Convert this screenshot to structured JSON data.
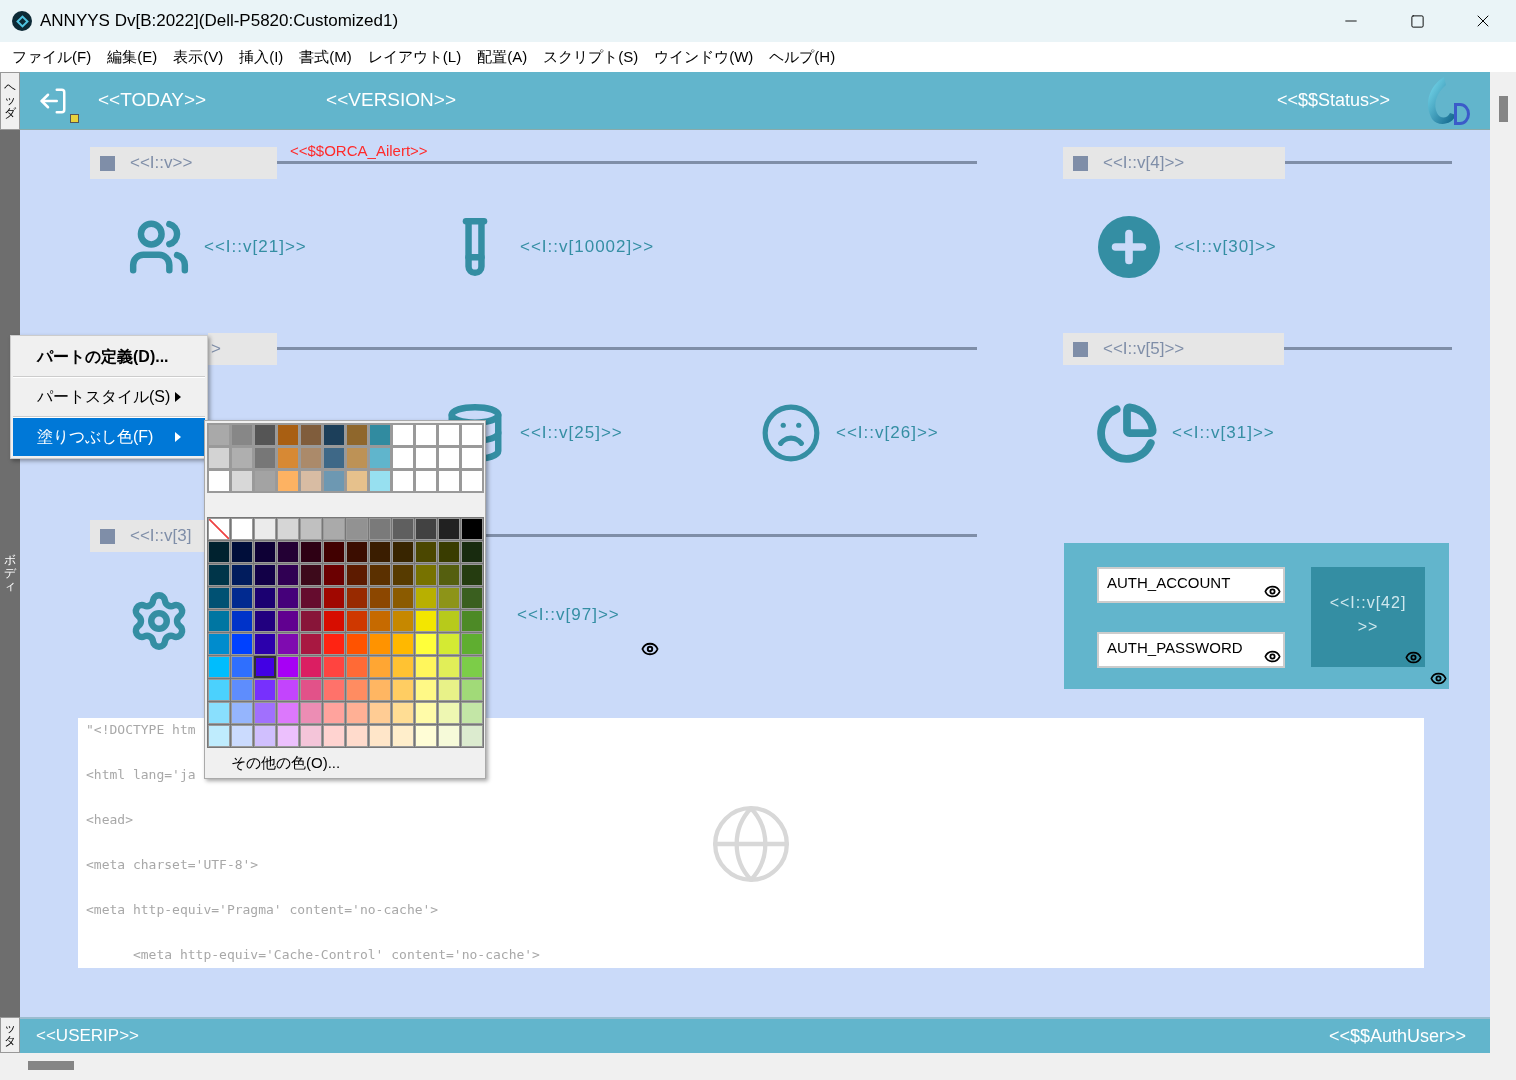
{
  "window": {
    "title": "ANNYYS Dv[B:2022](Dell-P5820:Customized1)"
  },
  "menu_bar": [
    "ファイル(F)",
    "編集(E)",
    "表示(V)",
    "挿入(I)",
    "書式(M)",
    "レイアウト(L)",
    "配置(A)",
    "スクリプト(S)",
    "ウインドウ(W)",
    "ヘルプ(H)"
  ],
  "bands": {
    "header": "ヘッダ",
    "body": "ボディ",
    "footer": "ッタ"
  },
  "header": {
    "today": "<<TODAY>>",
    "version": "<<VERSION>>",
    "status": "<<$$Status>>"
  },
  "alert": "<<$$ORCA_Ailert>>",
  "group_bars": [
    {
      "label": "<<I::v>>",
      "kind": "full"
    },
    {
      "label": "<<I::v[4]>>",
      "kind": "full"
    },
    {
      "label": ">",
      "kind": "tail"
    },
    {
      "label": "<<I::v[5]>>",
      "kind": "full"
    },
    {
      "label": "<<I::v[3]",
      "kind": "full"
    }
  ],
  "fields": [
    {
      "kind": "people",
      "label": "<<I::v[21]>>"
    },
    {
      "kind": "tube",
      "label": "<<I::v[10002]>>"
    },
    {
      "kind": "plus",
      "label": "<<I::v[30]>>"
    },
    {
      "kind": "database",
      "label": "<<I::v[25]>>"
    },
    {
      "kind": "sad",
      "label": "<<I::v[26]>>"
    },
    {
      "kind": "pie",
      "label": "<<I::v[31]>>"
    },
    {
      "kind": "gear"
    },
    {
      "kind": "none",
      "label": "<<I::v[97]>>"
    }
  ],
  "auth": {
    "account": "AUTH_ACCOUNT",
    "password": "AUTH_PASSWORD",
    "box_label": "<<I::v[42]\n>>"
  },
  "code_lines": [
    "\"<!DOCTYPE htm",
    "<html lang='ja",
    "<head>",
    "<meta charset='UTF-8'>",
    "<meta http-equiv='Pragma' content='no-cache'>",
    "      <meta http-equiv='Cache-Control' content='no-cache'>"
  ],
  "footer": {
    "left": "<<USERIP>>",
    "right": "<<$$AuthUser>>"
  },
  "context_menu": [
    {
      "label": "パートの定義(D)...",
      "submenu": false,
      "selected": false
    },
    {
      "label": "パートスタイル(S)",
      "submenu": true,
      "selected": false
    },
    {
      "label": "塗りつぶし色(F)",
      "submenu": true,
      "selected": true
    }
  ],
  "palette": {
    "custom_rows": [
      [
        {
          "color": "#a9a9a9",
          "selected": false
        },
        {
          "color": "#878787",
          "selected": false
        },
        {
          "color": "#555555",
          "selected": false
        },
        {
          "color": "#a95f12",
          "selected": false
        },
        {
          "color": "#805d3c",
          "selected": false
        },
        {
          "color": "#1c3f5a",
          "selected": false
        },
        {
          "color": "#8f672c",
          "selected": false
        },
        {
          "color": "#318ba0",
          "selected": false
        },
        {
          "color": "#ffffff",
          "selected": false
        },
        {
          "color": "#ffffff",
          "selected": false
        },
        {
          "color": "#ffffff",
          "selected": false
        },
        {
          "color": "#ffffff",
          "selected": false
        }
      ],
      [
        {
          "color": "#d3d3d3",
          "selected": false
        },
        {
          "color": "#afafaf",
          "selected": false
        },
        {
          "color": "#777777",
          "selected": false
        },
        {
          "color": "#d78934",
          "selected": false
        },
        {
          "color": "#ab8a6a",
          "selected": false
        },
        {
          "color": "#3e6887",
          "selected": false
        },
        {
          "color": "#bd9256",
          "selected": false
        },
        {
          "color": "#60b5cc",
          "selected": false
        },
        {
          "color": "#ffffff",
          "selected": false
        },
        {
          "color": "#ffffff",
          "selected": false
        },
        {
          "color": "#ffffff",
          "selected": false
        },
        {
          "color": "#ffffff",
          "selected": false
        }
      ],
      [
        {
          "color": "#ffffff",
          "selected": false
        },
        {
          "color": "#d8d8d8",
          "selected": false
        },
        {
          "color": "#a3a3a3",
          "selected": false
        },
        {
          "color": "#fdb262",
          "selected": false
        },
        {
          "color": "#d8bca3",
          "selected": false
        },
        {
          "color": "#6d98b2",
          "selected": false
        },
        {
          "color": "#e6c18c",
          "selected": false
        },
        {
          "color": "#97e0f0",
          "selected": false
        },
        {
          "color": "#ffffff",
          "selected": false
        },
        {
          "color": "#ffffff",
          "selected": false
        },
        {
          "color": "#ffffff",
          "selected": false
        },
        {
          "color": "#ffffff",
          "selected": false
        }
      ]
    ],
    "no_fill_swatch": {
      "selected": false
    },
    "gray_row": [
      {
        "color": "#ffffff",
        "selected": false
      },
      {
        "color": "#ebebeb",
        "selected": false
      },
      {
        "color": "#d6d6d6",
        "selected": false
      },
      {
        "color": "#c0c0c0",
        "selected": false
      },
      {
        "color": "#aaaaaa",
        "selected": false
      },
      {
        "color": "#929292",
        "selected": false
      },
      {
        "color": "#7a7a7a",
        "selected": false
      },
      {
        "color": "#5f5f5f",
        "selected": false
      },
      {
        "color": "#424242",
        "selected": false
      },
      {
        "color": "#212121",
        "selected": false
      },
      {
        "color": "#000000",
        "selected": false
      }
    ],
    "color_rows": [
      [
        {
          "color": "#00222f",
          "selected": false
        },
        {
          "color": "#000e3a",
          "selected": false
        },
        {
          "color": "#0e0035",
          "selected": false
        },
        {
          "color": "#230034",
          "selected": false
        },
        {
          "color": "#2e0014",
          "selected": false
        },
        {
          "color": "#410000",
          "selected": false
        },
        {
          "color": "#3b0d00",
          "selected": false
        },
        {
          "color": "#3a1d00",
          "selected": false
        },
        {
          "color": "#382500",
          "selected": false
        },
        {
          "color": "#4b4700",
          "selected": false
        },
        {
          "color": "#393c00",
          "selected": false
        },
        {
          "color": "#182b0f",
          "selected": false
        }
      ],
      [
        {
          "color": "#003549",
          "selected": false
        },
        {
          "color": "#011c5d",
          "selected": false
        },
        {
          "color": "#120047",
          "selected": false
        },
        {
          "color": "#300053",
          "selected": false
        },
        {
          "color": "#3d0a1b",
          "selected": false
        },
        {
          "color": "#6b0001",
          "selected": false
        },
        {
          "color": "#5d1b00",
          "selected": false
        },
        {
          "color": "#5b3000",
          "selected": false
        },
        {
          "color": "#573b00",
          "selected": false
        },
        {
          "color": "#777200",
          "selected": false
        },
        {
          "color": "#555f0f",
          "selected": false
        },
        {
          "color": "#253c10",
          "selected": false
        }
      ],
      [
        {
          "color": "#005173",
          "selected": false
        },
        {
          "color": "#012a90",
          "selected": false
        },
        {
          "color": "#1b0071",
          "selected": false
        },
        {
          "color": "#45007a",
          "selected": false
        },
        {
          "color": "#650c2e",
          "selected": false
        },
        {
          "color": "#a00700",
          "selected": false
        },
        {
          "color": "#982a00",
          "selected": false
        },
        {
          "color": "#8c4700",
          "selected": false
        },
        {
          "color": "#8b5b00",
          "selected": false
        },
        {
          "color": "#b8b000",
          "selected": false
        },
        {
          "color": "#8d9418",
          "selected": false
        },
        {
          "color": "#3a5f1f",
          "selected": false
        }
      ],
      [
        {
          "color": "#0076a2",
          "selected": false
        },
        {
          "color": "#0033c9",
          "selected": false
        },
        {
          "color": "#21007f",
          "selected": false
        },
        {
          "color": "#610090",
          "selected": false
        },
        {
          "color": "#881539",
          "selected": false
        },
        {
          "color": "#d70d00",
          "selected": false
        },
        {
          "color": "#cf3800",
          "selected": false
        },
        {
          "color": "#c66a00",
          "selected": false
        },
        {
          "color": "#c68800",
          "selected": false
        },
        {
          "color": "#f3e600",
          "selected": false
        },
        {
          "color": "#b7ca1b",
          "selected": false
        },
        {
          "color": "#4d8a26",
          "selected": false
        }
      ],
      [
        {
          "color": "#008ccd",
          "selected": false
        },
        {
          "color": "#0041ff",
          "selected": false
        },
        {
          "color": "#2c00ac",
          "selected": false
        },
        {
          "color": "#7f0bb0",
          "selected": false
        },
        {
          "color": "#a81841",
          "selected": false
        },
        {
          "color": "#ff2312",
          "selected": false
        },
        {
          "color": "#ff5300",
          "selected": false
        },
        {
          "color": "#ff9300",
          "selected": false
        },
        {
          "color": "#ffb800",
          "selected": false
        },
        {
          "color": "#ffff3a",
          "selected": false
        },
        {
          "color": "#d4ea33",
          "selected": false
        },
        {
          "color": "#5fae30",
          "selected": false
        }
      ],
      [
        {
          "color": "#00bdfd",
          "selected": false
        },
        {
          "color": "#2f6ffe",
          "selected": false
        },
        {
          "color": "#4200e4",
          "selected": true
        },
        {
          "color": "#a700f5",
          "selected": false
        },
        {
          "color": "#db1e62",
          "selected": false
        },
        {
          "color": "#ff4440",
          "selected": false
        },
        {
          "color": "#ff6a36",
          "selected": false
        },
        {
          "color": "#ffa633",
          "selected": false
        },
        {
          "color": "#ffc232",
          "selected": false
        },
        {
          "color": "#fff65c",
          "selected": false
        },
        {
          "color": "#e1ee58",
          "selected": false
        },
        {
          "color": "#7ccd48",
          "selected": false
        }
      ],
      [
        {
          "color": "#4bd1fd",
          "selected": false
        },
        {
          "color": "#5e8dfd",
          "selected": false
        },
        {
          "color": "#7730fd",
          "selected": false
        },
        {
          "color": "#c344fd",
          "selected": false
        },
        {
          "color": "#e25289",
          "selected": false
        },
        {
          "color": "#ff726a",
          "selected": false
        },
        {
          "color": "#ff8c61",
          "selected": false
        },
        {
          "color": "#ffb662",
          "selected": false
        },
        {
          "color": "#ffcd62",
          "selected": false
        },
        {
          "color": "#fff986",
          "selected": false
        },
        {
          "color": "#e8f288",
          "selected": false
        },
        {
          "color": "#a1da78",
          "selected": false
        }
      ],
      [
        {
          "color": "#89dffd",
          "selected": false
        },
        {
          "color": "#95b5fd",
          "selected": false
        },
        {
          "color": "#a170fd",
          "selected": false
        },
        {
          "color": "#dc78fc",
          "selected": false
        },
        {
          "color": "#ec8db4",
          "selected": false
        },
        {
          "color": "#ffa39d",
          "selected": false
        },
        {
          "color": "#ffb095",
          "selected": false
        },
        {
          "color": "#ffcc94",
          "selected": false
        },
        {
          "color": "#ffdd94",
          "selected": false
        },
        {
          "color": "#fffba8",
          "selected": false
        },
        {
          "color": "#eef7b2",
          "selected": false
        },
        {
          "color": "#c3e6a6",
          "selected": false
        }
      ],
      [
        {
          "color": "#bfecfd",
          "selected": false
        },
        {
          "color": "#cbdbfe",
          "selected": false
        },
        {
          "color": "#d0bffe",
          "selected": false
        },
        {
          "color": "#ecc0fd",
          "selected": false
        },
        {
          "color": "#f4c5d9",
          "selected": false
        },
        {
          "color": "#ffd3d0",
          "selected": false
        },
        {
          "color": "#ffdbcc",
          "selected": false
        },
        {
          "color": "#ffe6c9",
          "selected": false
        },
        {
          "color": "#ffeecb",
          "selected": false
        },
        {
          "color": "#fffdd6",
          "selected": false
        },
        {
          "color": "#f6fad9",
          "selected": false
        },
        {
          "color": "#dcebcf",
          "selected": false
        }
      ]
    ],
    "more_colors": "その他の色(O)..."
  }
}
